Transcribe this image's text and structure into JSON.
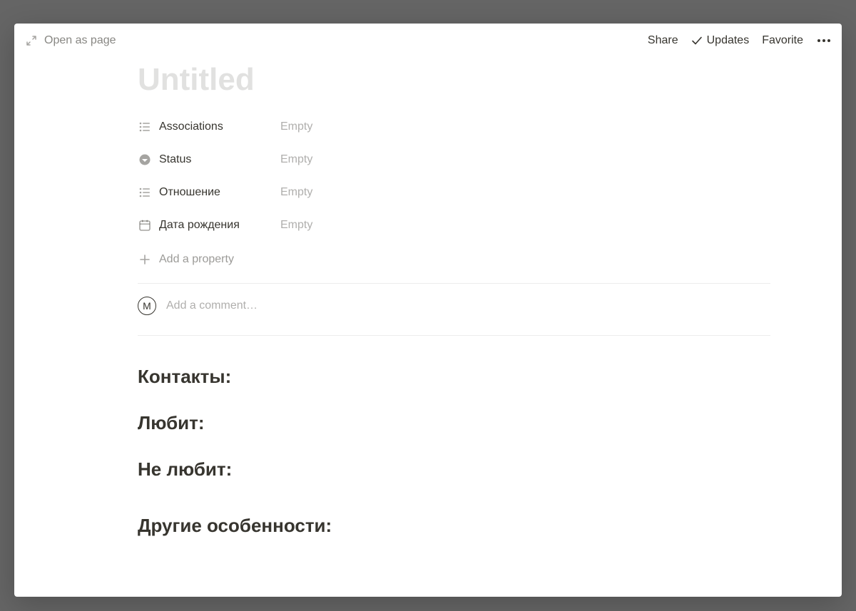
{
  "header": {
    "openAsPage": "Open as page",
    "share": "Share",
    "updates": "Updates",
    "favorite": "Favorite"
  },
  "page": {
    "titlePlaceholder": "Untitled"
  },
  "properties": [
    {
      "icon": "list",
      "label": "Associations",
      "value": "Empty"
    },
    {
      "icon": "status",
      "label": "Status",
      "value": "Empty"
    },
    {
      "icon": "list",
      "label": "Отношение",
      "value": "Empty"
    },
    {
      "icon": "date",
      "label": "Дата рождения",
      "value": "Empty"
    }
  ],
  "addProperty": "Add a property",
  "comment": {
    "avatarInitial": "M",
    "placeholder": "Add a comment…"
  },
  "headings": [
    "Контакты:",
    "Любит:",
    "Не любит:",
    "Другие особенности:"
  ]
}
